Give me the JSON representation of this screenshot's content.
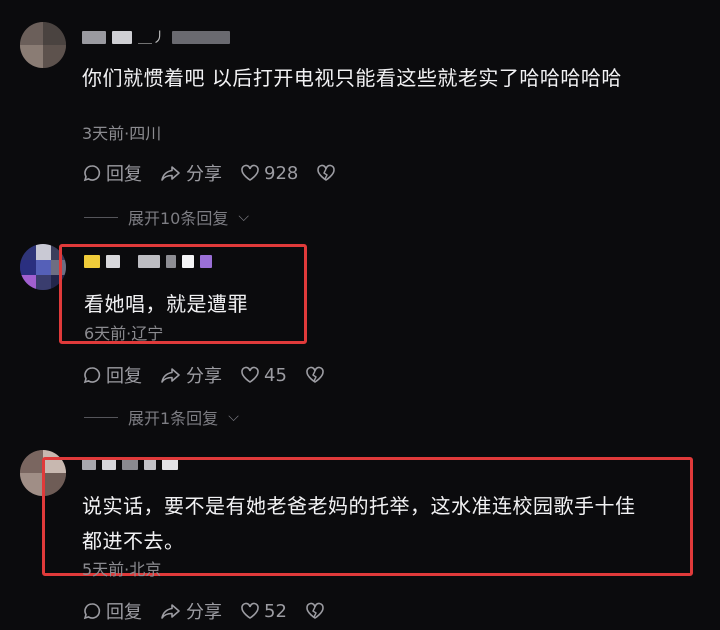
{
  "comments": [
    {
      "username": "＿丿",
      "text": "你们就惯着吧 以后打开电视只能看这些就老实了哈哈哈哈哈",
      "meta": "3天前·四川",
      "reply_label": "回复",
      "share_label": "分享",
      "likes": "928",
      "expand_label": "展开10条回复"
    },
    {
      "text": "看她唱，就是遭罪",
      "meta": "6天前·辽宁",
      "reply_label": "回复",
      "share_label": "分享",
      "likes": "45",
      "expand_label": "展开1条回复"
    },
    {
      "text_line1": "说实话，要不是有她老爸老妈的托举，这水准连校园歌手十佳",
      "text_line2": "都进不去。",
      "meta": "5天前·北京",
      "reply_label": "回复",
      "share_label": "分享",
      "likes": "52"
    }
  ],
  "colors": {
    "background": "#0b0b0d",
    "highlight": "#e03a3a",
    "muted_text": "#8b8b90"
  }
}
